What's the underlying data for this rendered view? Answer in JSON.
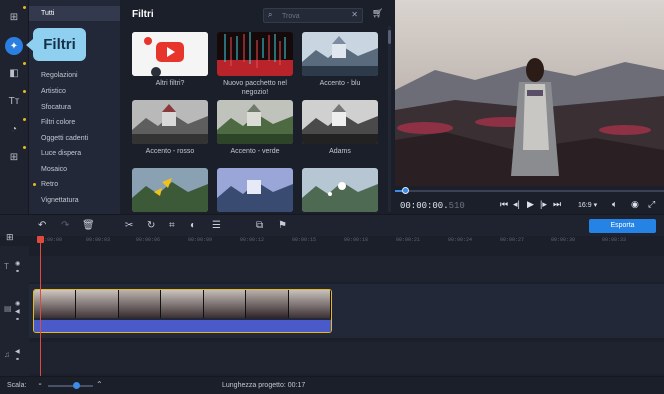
{
  "callout": {
    "label": "Filtri"
  },
  "categories": [
    {
      "label": "Tutti",
      "selected": true,
      "new": false
    },
    {
      "label": "Regolazioni",
      "selected": false,
      "new": false
    },
    {
      "label": "Artistico",
      "selected": false,
      "new": false
    },
    {
      "label": "Sfocatura",
      "selected": false,
      "new": false
    },
    {
      "label": "Filtri colore",
      "selected": false,
      "new": false
    },
    {
      "label": "Oggetti cadenti",
      "selected": false,
      "new": false
    },
    {
      "label": "Luce dispera",
      "selected": false,
      "new": false
    },
    {
      "label": "Mosaico",
      "selected": false,
      "new": false
    },
    {
      "label": "Retro",
      "selected": false,
      "new": true
    },
    {
      "label": "Vignettatura",
      "selected": false,
      "new": false
    }
  ],
  "panel": {
    "title": "Filtri",
    "search_placeholder": "Trova",
    "tiles": [
      {
        "label": "Altri filtri?"
      },
      {
        "label": "Nuovo pacchetto nel negozio!"
      },
      {
        "label": "Accento - blu"
      },
      {
        "label": "Accento - rosso"
      },
      {
        "label": "Accento - verde"
      },
      {
        "label": "Adams"
      },
      {
        "label": ""
      },
      {
        "label": ""
      },
      {
        "label": ""
      }
    ]
  },
  "preview": {
    "timecode_main": "00:00:00.",
    "timecode_ms": "510",
    "aspect": "16:9",
    "progress": 0.03
  },
  "toolbar": {
    "export_label": "Esporta"
  },
  "ruler": {
    "ticks": [
      "00:00:00",
      "00:00:03",
      "00:00:06",
      "00:00:09",
      "00:00:12",
      "00:00:15",
      "00:00:18",
      "00:00:21",
      "00:00:24",
      "00:00:27",
      "00:00:30",
      "00:00:33"
    ]
  },
  "status": {
    "scale_label": "Scala:",
    "project_length": "Lunghezza progetto: 00:17",
    "zoom": 0.6
  },
  "colors": {
    "accent": "#2583e6",
    "highlight": "#e6b820",
    "playhead": "#e04a3c",
    "callout": "#8fd0f0"
  }
}
